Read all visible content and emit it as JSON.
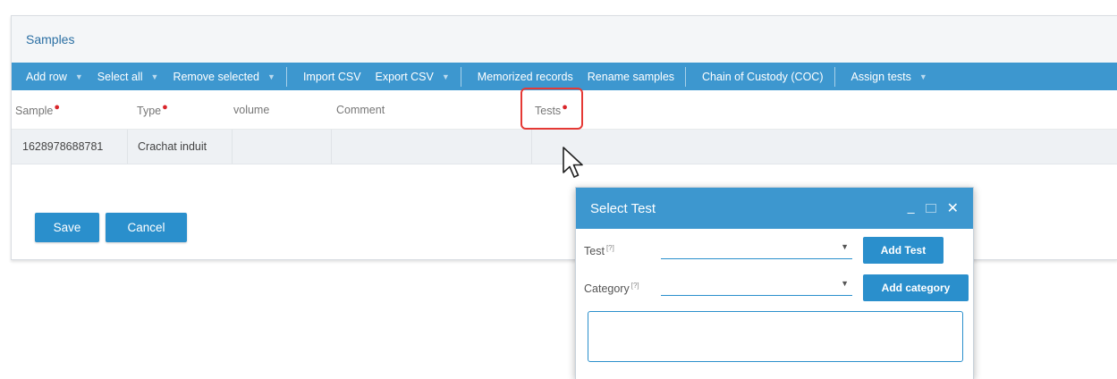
{
  "panel": {
    "title": "Samples"
  },
  "toolbar": {
    "add_row": "Add row",
    "select_all": "Select all",
    "remove_selected": "Remove selected",
    "import_csv": "Import CSV",
    "export_csv": "Export CSV",
    "memorized_records": "Memorized records",
    "rename_samples": "Rename samples",
    "chain_of_custody": "Chain of Custody (COC)",
    "assign_tests": "Assign tests"
  },
  "columns": {
    "sample": "Sample",
    "type": "Type",
    "volume": "volume",
    "comment": "Comment",
    "tests": "Tests"
  },
  "rows": [
    {
      "sample": "1628978688781",
      "type": "Crachat induit",
      "volume": "",
      "comment": "",
      "tests": ""
    }
  ],
  "actions": {
    "save": "Save",
    "cancel": "Cancel"
  },
  "dialog": {
    "title": "Select Test",
    "test_label": "Test",
    "category_label": "Category",
    "help_mark": "[?]",
    "add_test": "Add Test",
    "add_category": "Add category"
  },
  "colors": {
    "accent": "#3d97cf",
    "required": "#d9262b",
    "highlight": "#e53935"
  }
}
